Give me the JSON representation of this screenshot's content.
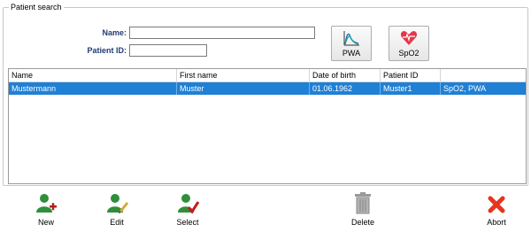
{
  "group_title": "Patient search",
  "form": {
    "name_label": "Name:",
    "name_value": "",
    "patient_id_label": "Patient ID:",
    "patient_id_value": ""
  },
  "tools": {
    "pwa_label": "PWA",
    "spo2_label": "SpO2"
  },
  "table": {
    "columns": [
      "Name",
      "First name",
      "Date of birth",
      "Patient ID",
      ""
    ],
    "rows": [
      {
        "name": "Mustermann",
        "first_name": "Muster",
        "dob": "01.06.1962",
        "patient_id": "Muster1",
        "tests": "SpO2, PWA"
      }
    ]
  },
  "actions": {
    "new_label": "New",
    "edit_label": "Edit",
    "select_label": "Select",
    "delete_label": "Delete",
    "abort_label": "Abort"
  },
  "colors": {
    "selection": "#1f80d6",
    "label_text": "#1f3b74",
    "abort": "#e8341c",
    "heart": "#e0394c"
  }
}
